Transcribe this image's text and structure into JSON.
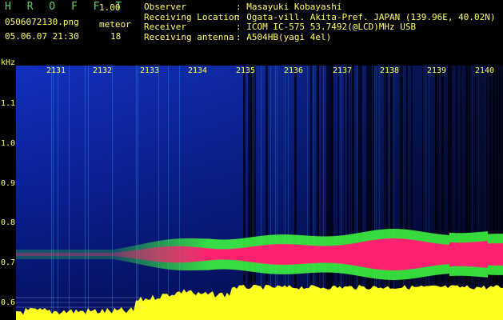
{
  "header": {
    "app_title": "H R O F F T",
    "version": "1.00",
    "filename": "0506072130.png",
    "datetime": "05.06.07 21:30",
    "meteor_label": "meteor",
    "meteor_count": "18"
  },
  "station": [
    {
      "label": "Observer",
      "sep": ":",
      "value": "Masayuki Kobayashi"
    },
    {
      "label": "Receiving Location",
      "sep": ":",
      "value": "Ogata-vill. Akita-Pref. JAPAN (139.96E, 40.02N)"
    },
    {
      "label": "Receiver",
      "sep": ":",
      "value": "ICOM IC-575 53.7492(@LCD)MHz USB"
    },
    {
      "label": "Receiving antenna",
      "sep": ":",
      "value": "A504HB(yagi 4el)"
    }
  ],
  "axis": {
    "unit": "kHz",
    "y_ticks": [
      "1.1",
      "1.0",
      "0.9",
      "0.8",
      "0.7",
      "0.6"
    ],
    "x_ticks": [
      "2131",
      "2132",
      "2133",
      "2134",
      "2135",
      "2136",
      "2137",
      "2138",
      "2139",
      "2140"
    ]
  },
  "colors": {
    "text": "#ffff55",
    "title": "#5fd35f",
    "noise_dark": "#000033",
    "noise_blue": "#1a3cff",
    "signal_red": "#ff2070",
    "signal_green": "#40ff40",
    "floor_yellow": "#ffff20"
  }
}
